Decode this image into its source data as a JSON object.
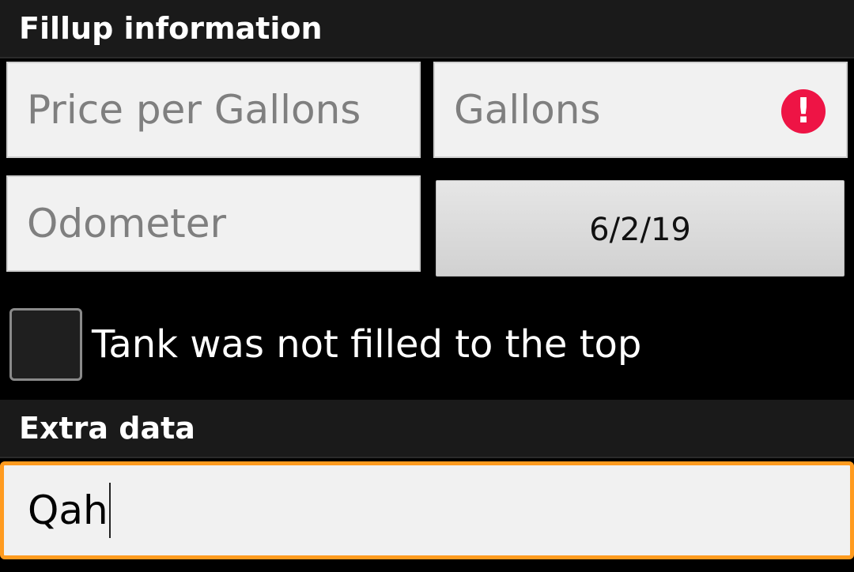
{
  "sections": {
    "fillup_header": "Fillup information",
    "extra_header": "Extra data"
  },
  "fields": {
    "price_placeholder": "Price per Gallons",
    "gallons_placeholder": "Gallons",
    "odometer_placeholder": "Odometer",
    "extra_value": "Qah"
  },
  "date_button": {
    "label": "6/2/19"
  },
  "checkbox": {
    "label": "Tank was not filled to the top",
    "checked": false
  },
  "icons": {
    "gallons_error": "error-icon",
    "error_color": "#ee1445"
  },
  "colors": {
    "focus_accent": "#ff9b1f",
    "field_background": "#f1f1f1",
    "header_background": "#1a1a1a"
  }
}
